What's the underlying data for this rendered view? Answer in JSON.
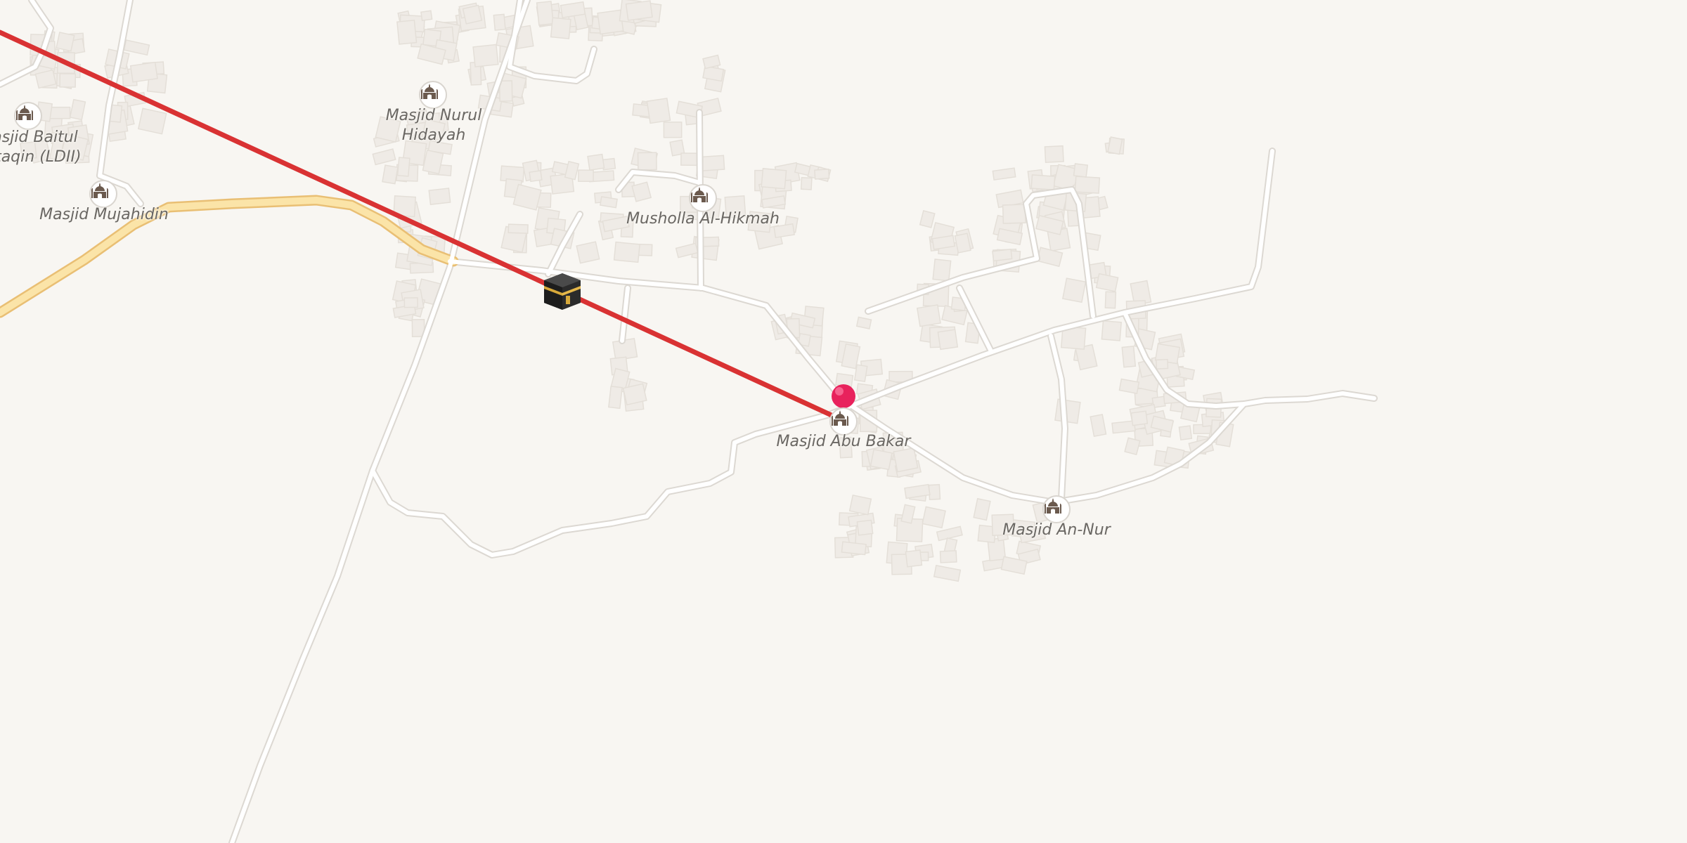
{
  "map": {
    "background_color": "#f8f6f2",
    "road_color": "#ffffff",
    "road_casing_color": "#dcd8d2",
    "main_road_color": "#fbe4a8",
    "main_road_casing_color": "#e9bf74",
    "building_color": "#efebe6",
    "qibla_line_color": "#d93233",
    "marker_color": "#e8225c"
  },
  "pois": [
    {
      "id": "masjid-baitul-muttaqin",
      "label_lines": [
        "asjid Baitul",
        "ttaqin (LDII)"
      ],
      "icon": "mosque-icon"
    },
    {
      "id": "masjid-nurul-hidayah",
      "label_lines": [
        "Masjid Nurul",
        "Hidayah"
      ],
      "icon": "mosque-icon"
    },
    {
      "id": "masjid-mujahidin",
      "label_lines": [
        "Masjid Mujahidin"
      ],
      "icon": "mosque-icon"
    },
    {
      "id": "musholla-al-hikmah",
      "label_lines": [
        "Musholla Al-Hikmah"
      ],
      "icon": "mosque-icon"
    },
    {
      "id": "masjid-abu-bakar",
      "label_lines": [
        "Masjid Abu Bakar"
      ],
      "icon": "mosque-icon"
    },
    {
      "id": "masjid-an-nur",
      "label_lines": [
        "Masjid An-Nur"
      ],
      "icon": "mosque-icon"
    }
  ],
  "kaaba_marker": {
    "icon": "kaaba-icon"
  },
  "location_marker": {
    "icon": "location-pin-icon"
  }
}
